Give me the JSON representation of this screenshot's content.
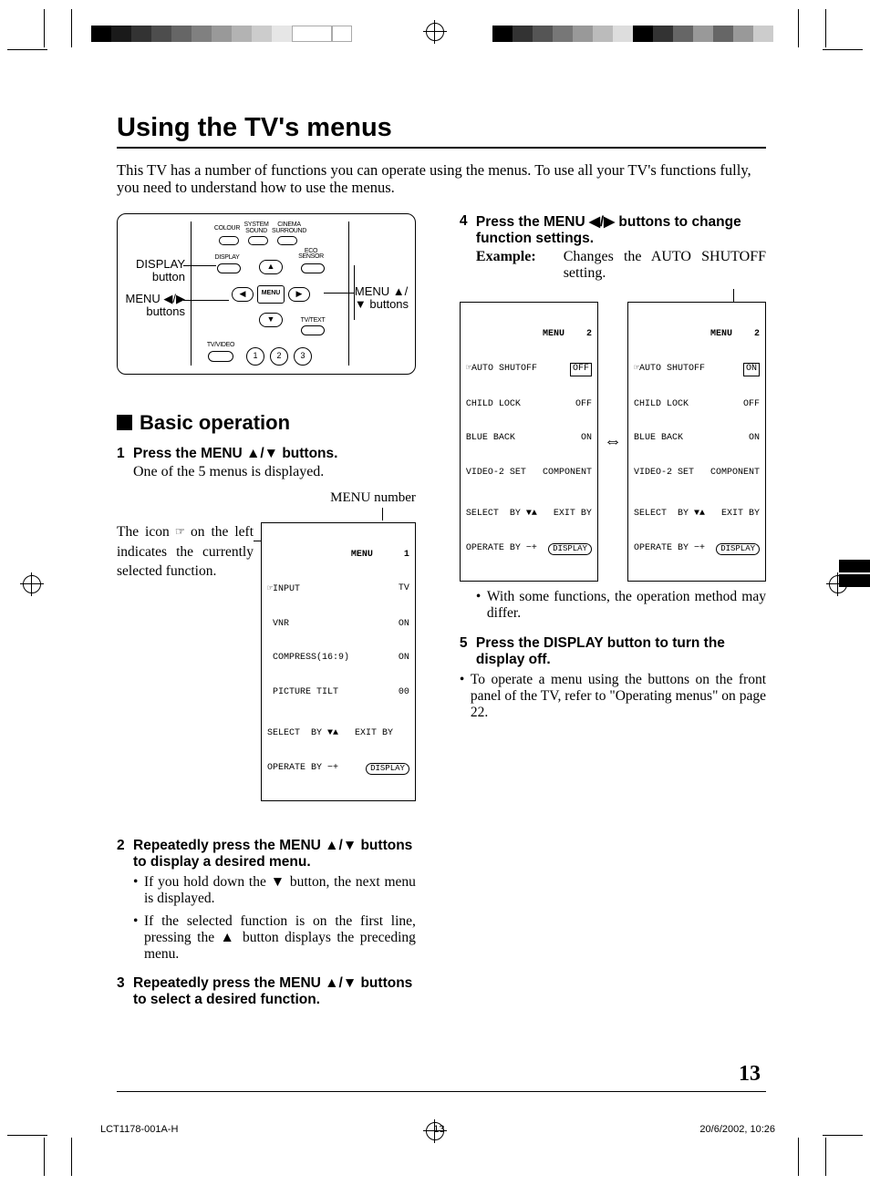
{
  "header": {
    "title": "Using the TV's menus"
  },
  "intro": "This TV has a number of functions you can operate using the menus. To use all your TV's functions fully, you need to understand how to use the menus.",
  "remote": {
    "callout_display": "DISPLAY button",
    "callout_menu_lr": "MENU ◀/▶ buttons",
    "callout_menu_ud": "MENU ▲/▼ buttons",
    "labels": {
      "colour": "COLOUR",
      "system": "SYSTEM",
      "sound": "SOUND",
      "cinema": "CINEMA",
      "surround": "SURROUND",
      "display": "DISPLAY",
      "eco": "ECO SENSOR",
      "menu": "MENU",
      "tvtext": "TV/TEXT",
      "tvvideo": "TV/VIDEO",
      "n1": "1",
      "n2": "2",
      "n3": "3"
    }
  },
  "section_basic": "Basic operation",
  "steps": {
    "s1": {
      "title": "Press the MENU ▲/▼ buttons.",
      "body": "One of the 5 menus is displayed.",
      "menunum_label": "MENU number",
      "note": "The icon      on the left indicates the currently selected function."
    },
    "s2": {
      "title": "Repeatedly press the MENU ▲/▼ buttons to display a desired menu.",
      "b1": "If you hold down the ▼ button, the next menu is displayed.",
      "b2": "If the selected function is on the first line, pressing the ▲ button displays the preceding menu."
    },
    "s3": {
      "title": "Repeatedly press the MENU ▲/▼ buttons to select a desired function."
    },
    "s4": {
      "title": "Press the MENU ◀/▶ buttons to change function settings.",
      "example_label": "Example:",
      "example_desc": "Changes the AUTO SHUTOFF setting.",
      "note": "With some functions, the operation method may differ."
    },
    "s5": {
      "title": "Press the DISPLAY button to turn the display off."
    },
    "tail": "To operate a menu using the buttons on the front panel of the TV, refer to \"Operating menus\" on page 22."
  },
  "osd": {
    "menu1": {
      "title": "MENU",
      "num": "1",
      "r1k": "INPUT",
      "r1v": "TV",
      "r2k": " VNR",
      "r2v": "ON",
      "r3k": " COMPRESS(16:9)",
      "r3v": "ON",
      "r4k": " PICTURE TILT",
      "r4v": "00",
      "f1": "SELECT  BY ▼▲   EXIT BY",
      "f2": "OPERATE BY −+",
      "disp": "DISPLAY"
    },
    "menu2a": {
      "title": "MENU",
      "num": "2",
      "r1k": "AUTO SHUTOFF",
      "r1v": "OFF",
      "r2k": "CHILD LOCK",
      "r2v": "OFF",
      "r3k": "BLUE BACK",
      "r3v": "ON",
      "r4k": "VIDEO-2 SET",
      "r4v": "COMPONENT",
      "f1": "SELECT  BY ▼▲   EXIT BY",
      "f2": "OPERATE BY −+",
      "disp": "DISPLAY"
    },
    "menu2b": {
      "title": "MENU",
      "num": "2",
      "r1k": "AUTO SHUTOFF",
      "r1v": "ON",
      "r2k": "CHILD LOCK",
      "r2v": "OFF",
      "r3k": "BLUE BACK",
      "r3v": "ON",
      "r4k": "VIDEO-2 SET",
      "r4v": "COMPONENT",
      "f1": "SELECT  BY ▼▲   EXIT BY",
      "f2": "OPERATE BY −+",
      "disp": "DISPLAY"
    }
  },
  "page_number": "13",
  "footer": {
    "code": "LCT1178-001A-H",
    "page": "13",
    "date": "20/6/2002, 10:26"
  }
}
